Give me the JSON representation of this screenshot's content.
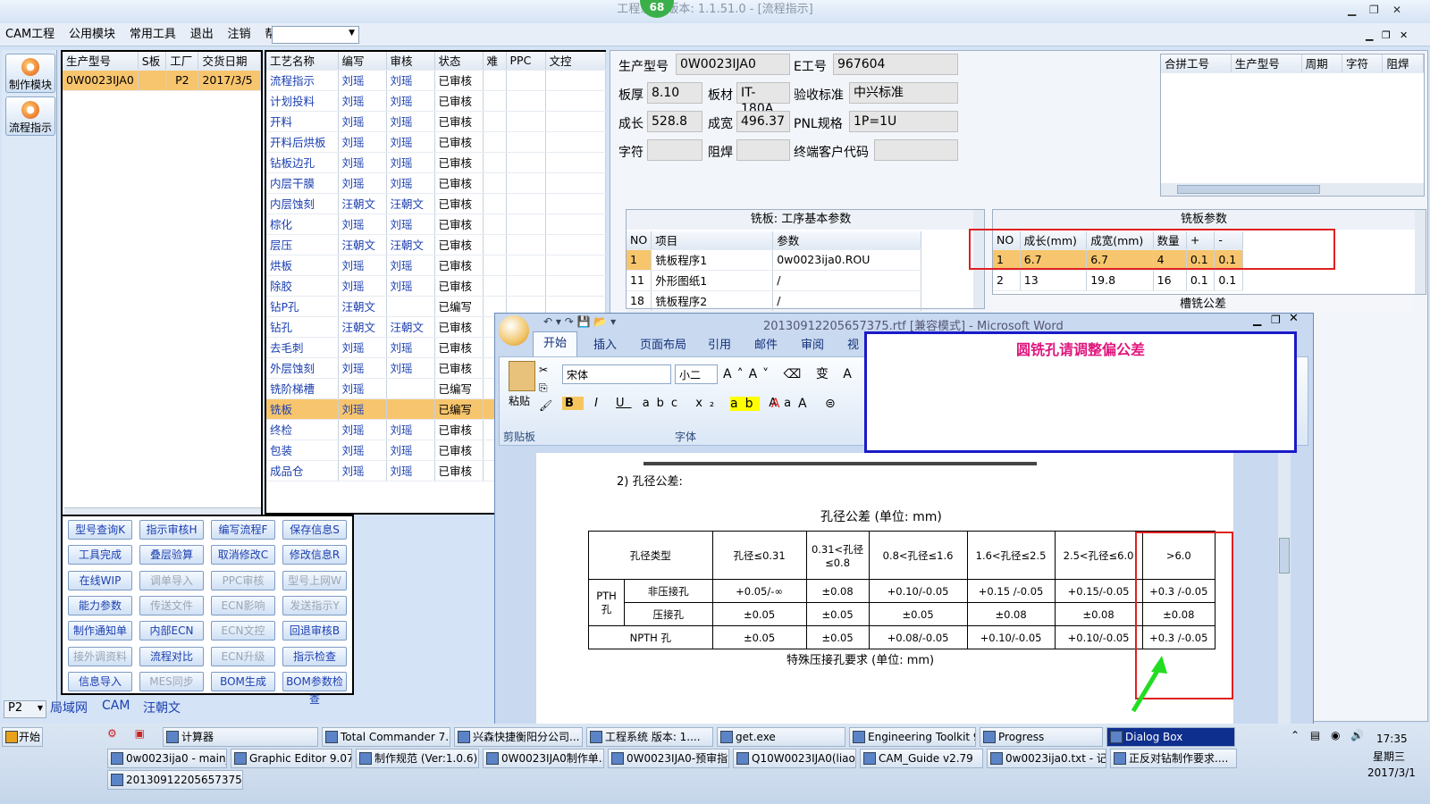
{
  "window": {
    "title": "工程系统 版本: 1.1.51.0 - [流程指示]",
    "badge": "68"
  },
  "menu": {
    "items": [
      "CAM工程",
      "公用模块",
      "常用工具",
      "退出",
      "注销",
      "帮助"
    ]
  },
  "sidebar": {
    "buttons": [
      "制作模块",
      "流程指示"
    ]
  },
  "orders": {
    "headers": [
      "生产型号",
      "S板",
      "工厂",
      "交货日期"
    ],
    "row": [
      "0W0023IJA0",
      "",
      "P2",
      "2017/3/5"
    ]
  },
  "process": {
    "headers": [
      "工艺名称",
      "编写",
      "审核",
      "状态",
      "难",
      "PPC",
      "文控"
    ],
    "rows": [
      [
        "流程指示",
        "刘瑶",
        "刘瑶",
        "已审核"
      ],
      [
        "计划投料",
        "刘瑶",
        "刘瑶",
        "已审核"
      ],
      [
        "开料",
        "刘瑶",
        "刘瑶",
        "已审核"
      ],
      [
        "开料后烘板",
        "刘瑶",
        "刘瑶",
        "已审核"
      ],
      [
        "钻板边孔",
        "刘瑶",
        "刘瑶",
        "已审核"
      ],
      [
        "内层干膜",
        "刘瑶",
        "刘瑶",
        "已审核"
      ],
      [
        "内层蚀刻",
        "汪朝文",
        "汪朝文",
        "已审核"
      ],
      [
        "棕化",
        "刘瑶",
        "刘瑶",
        "已审核"
      ],
      [
        "层压",
        "汪朝文",
        "汪朝文",
        "已审核"
      ],
      [
        "烘板",
        "刘瑶",
        "刘瑶",
        "已审核"
      ],
      [
        "除胶",
        "刘瑶",
        "刘瑶",
        "已审核"
      ],
      [
        "钻P孔",
        "汪朝文",
        "",
        "已编写"
      ],
      [
        "钻孔",
        "汪朝文",
        "汪朝文",
        "已审核"
      ],
      [
        "去毛刺",
        "刘瑶",
        "刘瑶",
        "已审核"
      ],
      [
        "外层蚀刻",
        "刘瑶",
        "刘瑶",
        "已审核"
      ],
      [
        "铣阶梯槽",
        "刘瑶",
        "",
        "已编写"
      ],
      [
        "铣板",
        "刘瑶",
        "",
        "已编写"
      ],
      [
        "终检",
        "刘瑶",
        "刘瑶",
        "已审核"
      ],
      [
        "包装",
        "刘瑶",
        "刘瑶",
        "已审核"
      ],
      [
        "成品仓",
        "刘瑶",
        "刘瑶",
        "已审核"
      ]
    ]
  },
  "buttons": [
    [
      "型号查询K",
      "指示审核H",
      "编写流程F",
      "保存信息S"
    ],
    [
      "工具完成",
      "叠层验算",
      "取消修改C",
      "修改信息R"
    ],
    [
      "在线WIP",
      "调单导入",
      "PPC审核",
      "型号上网W"
    ],
    [
      "能力参数",
      "传送文件",
      "ECN影响",
      "发送指示Y"
    ],
    [
      "制作通知单",
      "内部ECN",
      "ECN文控",
      "回退审核B"
    ],
    [
      "接外调资料",
      "流程对比",
      "ECN升级",
      "指示检查"
    ],
    [
      "信息导入",
      "MES同步",
      "BOM生成",
      "BOM参数检查"
    ]
  ],
  "disabled": [
    "调单导入",
    "PPC审核",
    "型号上网W",
    "传送文件",
    "ECN影响",
    "发送指示Y",
    "ECN文控",
    "接外调资料",
    "ECN升级",
    "MES同步"
  ],
  "bottomTabs": {
    "combo": "P2",
    "tabs": [
      "局域网",
      "CAM",
      "汪朝文"
    ]
  },
  "info": {
    "labels": {
      "model": "生产型号",
      "e": "E工号",
      "thick": "板厚",
      "mat": "板材",
      "acc": "验收标准",
      "len": "成长",
      "wid": "成宽",
      "pnl": "PNL规格",
      "char": "字符",
      "mask": "阻焊",
      "cust": "终端客户代码"
    },
    "values": {
      "model": "0W0023IJA0",
      "e": "967604",
      "thick": "8.10",
      "mat": "IT-180A",
      "acc": "中兴标准",
      "len": "528.8",
      "wid": "496.37",
      "pnl": "1P=1U"
    }
  },
  "mergeTable": {
    "headers": [
      "合拼工号",
      "生产型号",
      "周期",
      "字符",
      "阻焊"
    ]
  },
  "routing": {
    "title": "铣板: 工序基本参数",
    "headers": [
      "NO",
      "项目",
      "参数"
    ],
    "rows": [
      [
        "1",
        "铣板程序1",
        "0w0023ija0.ROU"
      ],
      [
        "11",
        "外形图纸1",
        "/"
      ],
      [
        "18",
        "铣板程序2",
        "/"
      ]
    ]
  },
  "millParams": {
    "title": "铣板参数",
    "headers": [
      "NO",
      "成长(mm)",
      "成宽(mm)",
      "数量",
      "+",
      "-"
    ],
    "rows": [
      [
        "1",
        "6.7",
        "6.7",
        "4",
        "0.1",
        "0.1"
      ],
      [
        "2",
        "13",
        "19.8",
        "16",
        "0.1",
        "0.1"
      ]
    ],
    "slotTitle": "槽铣公差"
  },
  "word": {
    "title": "20130912205657375.rtf [兼容模式] - Microsoft Word",
    "tabs": [
      "开始",
      "插入",
      "页面布局",
      "引用",
      "邮件",
      "审阅",
      "视"
    ],
    "font": "宋体",
    "size": "小二",
    "groups": [
      "剪贴板",
      "字体"
    ],
    "paste": "粘贴"
  },
  "annotation": {
    "text": "圆铣孔请调整偏公差"
  },
  "doc": {
    "heading": "2) 孔径公差:",
    "caption": "孔径公差 (单位: mm)",
    "footer": "特殊压接孔要求 (单位: mm)",
    "headers": [
      "孔径类型",
      "孔径≤0.31",
      "0.31<孔径≤0.8",
      "0.8<孔径≤1.6",
      "1.6<孔径≤2.5",
      "2.5<孔径≤6.0",
      ">6.0"
    ],
    "pth": "PTH 孔",
    "rows": [
      [
        "非压接孔",
        "+0.05/-∞",
        "±0.08",
        "+0.10/-0.05",
        "+0.15 /-0.05",
        "+0.15/-0.05",
        "+0.3 /-0.05"
      ],
      [
        "压接孔",
        "±0.05",
        "±0.05",
        "±0.05",
        "±0.08",
        "±0.08",
        "±0.08"
      ],
      [
        "NPTH 孔",
        "±0.05",
        "±0.05",
        "+0.08/-0.05",
        "+0.10/-0.05",
        "+0.10/-0.05",
        "+0.3 /-0.05"
      ]
    ]
  },
  "taskbar": {
    "start": "开始",
    "row1": [
      "计算器",
      "Total Commander 7.0 ...",
      "兴森快捷衡阳分公司...",
      "工程系统 版本: 1....",
      "get.exe",
      "Engineering Toolkit 9....",
      "Progress",
      "Dialog Box"
    ],
    "row2": [
      "0w0023ija0 - main_qa",
      "Graphic Editor 9.07b...",
      "制作规范 (Ver:1.0.6)",
      "0W0023IJA0制作单....",
      "0W0023IJA0-预审指...",
      "Q10W0023IJA0(liaoq...",
      "CAM_Guide v2.79",
      "0w0023ija0.txt - 记...",
      "正反对钻制作要求...."
    ],
    "row3": [
      "20130912205657375...."
    ],
    "time": "17:35",
    "day": "星期三",
    "date": "2017/3/1"
  }
}
